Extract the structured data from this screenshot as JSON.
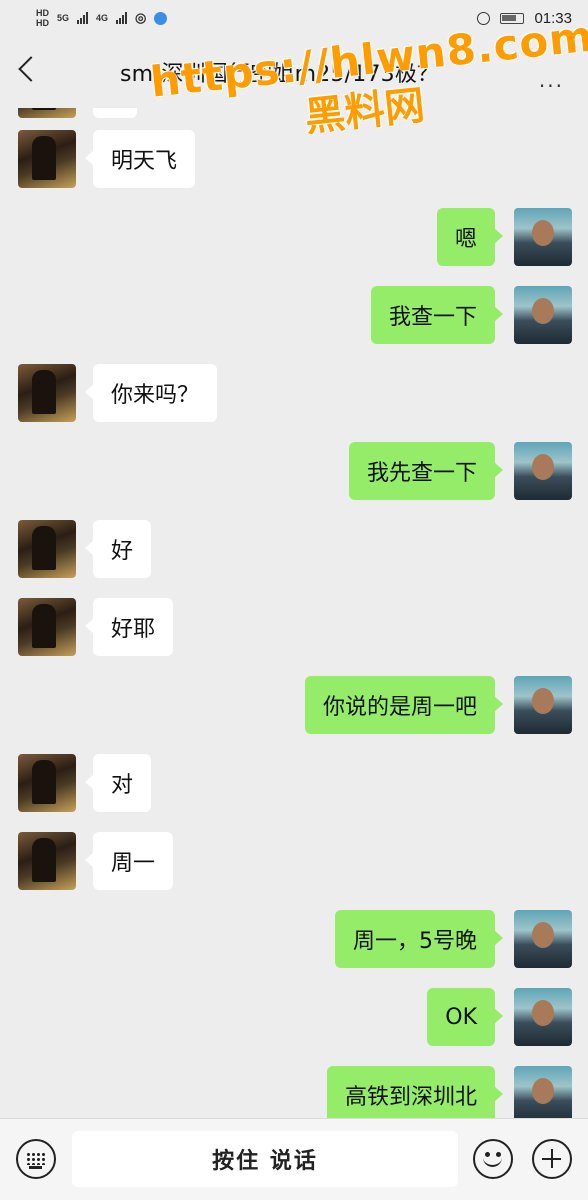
{
  "status_bar": {
    "left_hd1": "HD",
    "left_hd2": "HD",
    "net1": "5G",
    "net2": "4G",
    "time": "01:33"
  },
  "header": {
    "title": "sm-深圳国行空姐m25/173极？",
    "more": "···"
  },
  "watermark": {
    "url": "https://hlwn8.com",
    "name": "黑料网"
  },
  "messages": [
    {
      "side": "left",
      "text": ""
    },
    {
      "side": "left",
      "text": "明天飞"
    },
    {
      "side": "right",
      "text": "嗯"
    },
    {
      "side": "right",
      "text": "我查一下"
    },
    {
      "side": "left",
      "text": "你来吗？"
    },
    {
      "side": "right",
      "text": "我先查一下"
    },
    {
      "side": "left",
      "text": "好"
    },
    {
      "side": "left",
      "text": "好耶"
    },
    {
      "side": "right",
      "text": "你说的是周一吧"
    },
    {
      "side": "left",
      "text": "对"
    },
    {
      "side": "left",
      "text": "周一"
    },
    {
      "side": "right",
      "text": "周一，5号晚"
    },
    {
      "side": "right",
      "text": "OK"
    },
    {
      "side": "right",
      "text": "高铁到深圳北"
    }
  ],
  "input_bar": {
    "hold_to_talk": "按住 说话"
  },
  "colors": {
    "background": "#ededed",
    "sent_bubble": "#95ec69",
    "received_bubble": "#ffffff",
    "watermark": "#ff9c00"
  }
}
